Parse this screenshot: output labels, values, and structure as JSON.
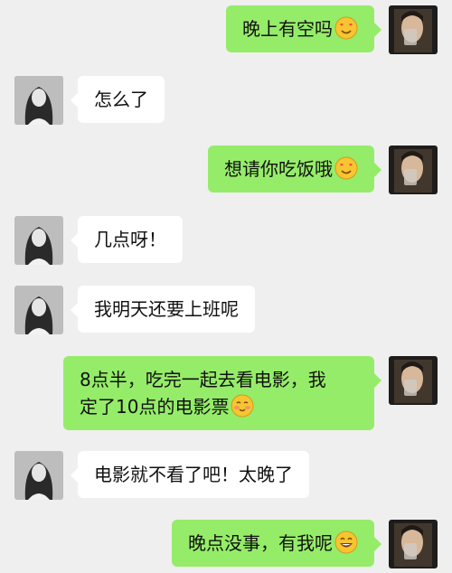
{
  "colors": {
    "background": "#efefef",
    "self_bubble": "#95ec69",
    "other_bubble": "#ffffff",
    "emoji": "#f7c531"
  },
  "messages": [
    {
      "side": "right",
      "text": "晚上有空吗",
      "emoji": "smiling-face-with-heart-eyes"
    },
    {
      "side": "left",
      "text": "怎么了"
    },
    {
      "side": "right",
      "text": "想请你吃饭哦",
      "emoji": "smiling-face-with-heart-eyes"
    },
    {
      "side": "left",
      "text": "几点呀！"
    },
    {
      "side": "left",
      "text": "我明天还要上班呢"
    },
    {
      "side": "right",
      "text_line1": "8点半，吃完一起去看电影，我",
      "text_line2": "定了10点的电影票",
      "emoji": "blushing-smile-face"
    },
    {
      "side": "left",
      "text": "电影就不看了吧！太晚了"
    },
    {
      "side": "right",
      "text": "晚点没事，有我呢",
      "emoji": "grinning-face-with-smiling-eyes"
    }
  ]
}
